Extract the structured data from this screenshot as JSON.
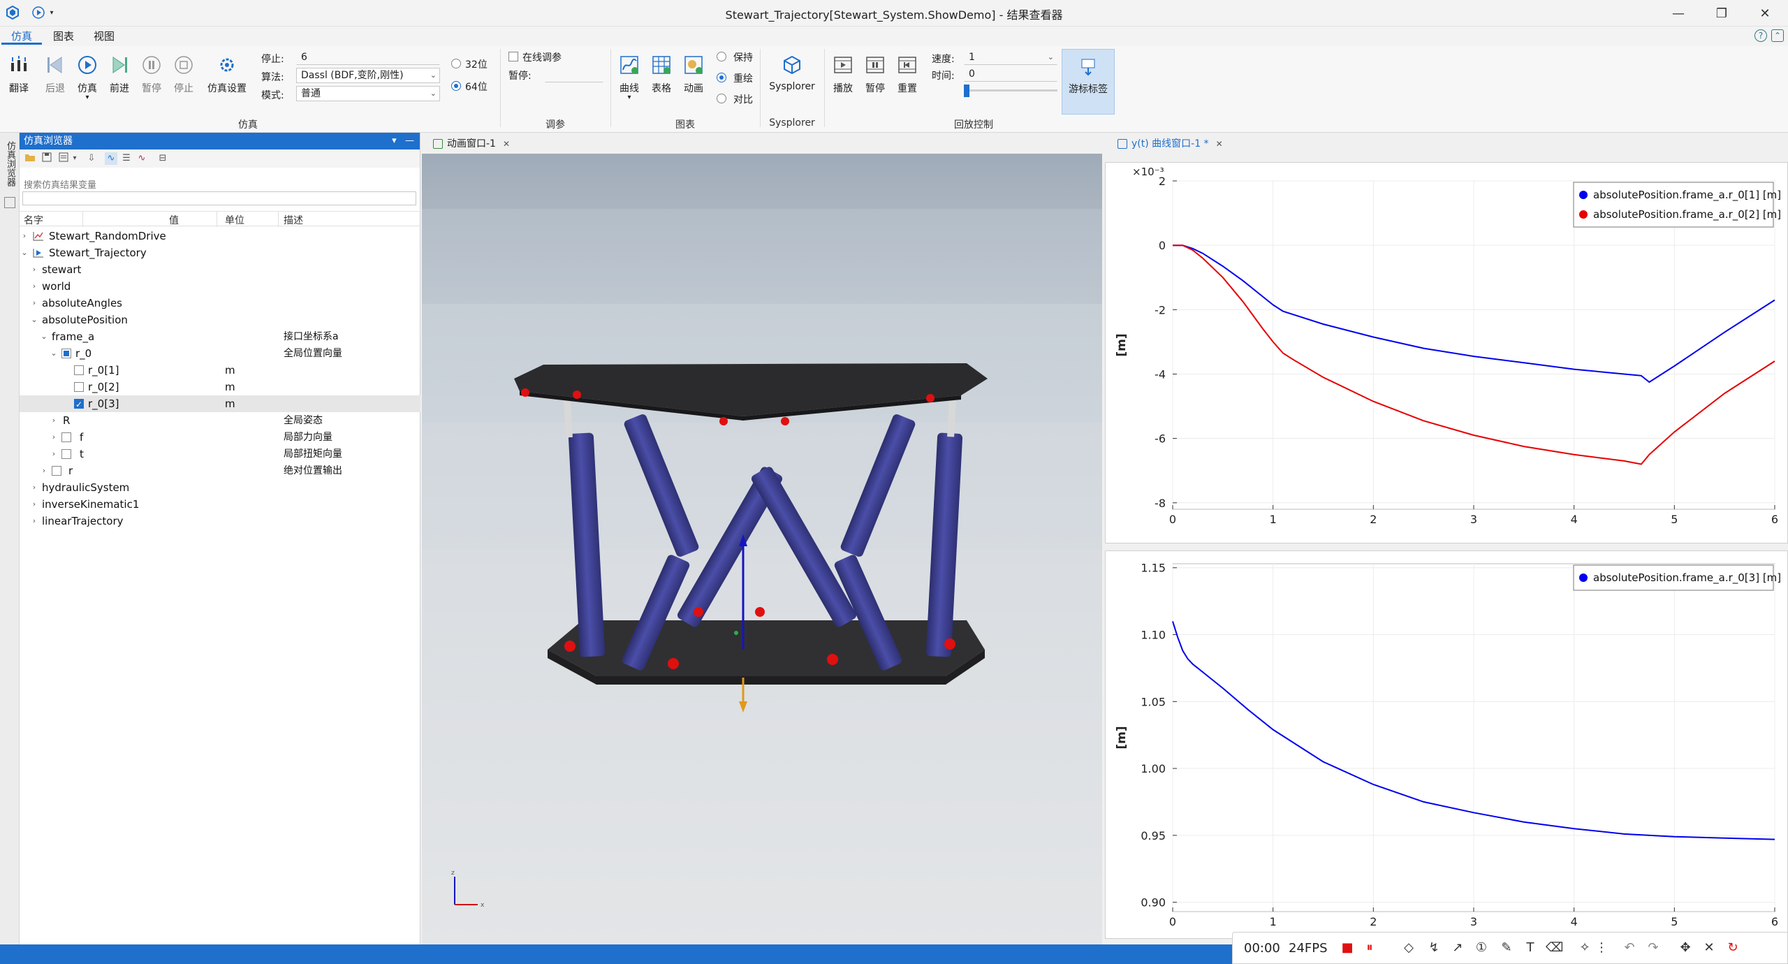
{
  "window": {
    "title": "Stewart_Trajectory[Stewart_System.ShowDemo] - 结果查看器",
    "controls": [
      "—",
      "❐",
      "✕"
    ]
  },
  "menu_tabs": [
    "仿真",
    "图表",
    "视图"
  ],
  "ribbon": {
    "sim_buttons": [
      "翻译",
      "后退",
      "仿真",
      "前进",
      "暂停",
      "停止",
      "仿真设置"
    ],
    "stop_label": "停止:",
    "stop_value": "6",
    "algo_label": "算法:",
    "algo_value": "Dassl (BDF,变阶,刚性)",
    "mode_label": "模式:",
    "mode_value": "普通",
    "bit32": "32位",
    "bit64": "64位",
    "sim_group": "仿真",
    "online_tune": "在线调参",
    "pause_label": "暂停:",
    "tune_group": "调参",
    "chart_buttons": [
      "曲线",
      "表格",
      "动画"
    ],
    "chart_radios": [
      "保持",
      "重绘",
      "对比"
    ],
    "chart_group": "图表",
    "sysplorer_button": "Sysplorer",
    "sysplorer_group": "Sysplorer",
    "playback_buttons": [
      "播放",
      "暂停",
      "重置"
    ],
    "speed_label": "速度:",
    "speed_value": "1",
    "time_label": "时间:",
    "time_value": "0",
    "cursor_tag": "游标标签",
    "playback_group": "回放控制"
  },
  "browser": {
    "vertical_tab": "仿真浏览器",
    "title": "仿真浏览器",
    "search_label": "搜索仿真结果变量",
    "columns": [
      "名字",
      "值",
      "单位",
      "描述"
    ],
    "tree": {
      "r0": "Stewart_RandomDrive",
      "r1": "Stewart_Trajectory",
      "r2": "stewart",
      "r3": "world",
      "r4": "absoluteAngles",
      "r5": "absolutePosition",
      "r6": "frame_a",
      "r6_desc": "接口坐标系a",
      "r7": "r_0",
      "r7_desc": "全局位置向量",
      "r8": "r_0[1]",
      "r8_unit": "m",
      "r9": "r_0[2]",
      "r9_unit": "m",
      "r10": "r_0[3]",
      "r10_unit": "m",
      "r11": "R",
      "r11_desc": "全局姿态",
      "r12": "f",
      "r12_desc": "局部力向量",
      "r13": "t",
      "r13_desc": "局部扭矩向量",
      "r14": "r",
      "r14_desc": "绝对位置输出",
      "r15": "hydraulicSystem",
      "r16": "inverseKinematic1",
      "r17": "linearTrajectory"
    }
  },
  "anim_tab": "动画窗口-1",
  "plot_tab": "y(t) 曲线窗口-1 *",
  "colors": {
    "accent": "#1f6fcc",
    "series_blue": "#0000ee",
    "series_red": "#e60000",
    "actuator": "#3c3e8e",
    "joint": "#e01010"
  },
  "recorder": {
    "time": "00:00",
    "fps": "24FPS"
  },
  "chart_data": [
    {
      "type": "line",
      "exponent_label": "×10⁻³",
      "ylabel": "[m]",
      "xlim": [
        0,
        6
      ],
      "ylim": [
        -8.2,
        2.0
      ],
      "xticks": [
        "0",
        "1",
        "2",
        "3",
        "4",
        "5",
        "6"
      ],
      "yticks": [
        "2",
        "0",
        "-2",
        "-4",
        "-6",
        "-8"
      ],
      "ytick_values": [
        2,
        0,
        -2,
        -4,
        -6,
        -8
      ],
      "legend_position": "top-right",
      "series": [
        {
          "name": "absolutePosition.frame_a.r_0[1] [m]",
          "color": "#0000ee",
          "x": [
            0,
            0.1,
            0.2,
            0.3,
            0.5,
            0.7,
            0.9,
            1.0,
            1.1,
            1.2,
            1.5,
            2.0,
            2.5,
            3.0,
            3.5,
            4.0,
            4.5,
            4.67,
            4.75,
            5.0,
            5.5,
            6.0
          ],
          "y": [
            0,
            0,
            -0.1,
            -0.25,
            -0.65,
            -1.1,
            -1.6,
            -1.85,
            -2.05,
            -2.15,
            -2.45,
            -2.85,
            -3.2,
            -3.45,
            -3.65,
            -3.85,
            -4.0,
            -4.05,
            -4.25,
            -3.75,
            -2.7,
            -1.7
          ]
        },
        {
          "name": "absolutePosition.frame_a.r_0[2] [m]",
          "color": "#e60000",
          "x": [
            0,
            0.1,
            0.2,
            0.3,
            0.5,
            0.7,
            0.9,
            1.0,
            1.1,
            1.2,
            1.5,
            2.0,
            2.5,
            3.0,
            3.5,
            4.0,
            4.5,
            4.67,
            4.75,
            5.0,
            5.5,
            6.0
          ],
          "y": [
            0,
            0,
            -0.15,
            -0.4,
            -1.0,
            -1.75,
            -2.6,
            -3.0,
            -3.35,
            -3.55,
            -4.1,
            -4.85,
            -5.45,
            -5.9,
            -6.25,
            -6.5,
            -6.7,
            -6.8,
            -6.5,
            -5.8,
            -4.6,
            -3.6
          ]
        }
      ]
    },
    {
      "type": "line",
      "ylabel": "[m]",
      "xlim": [
        0,
        6
      ],
      "ylim": [
        0.893,
        1.153
      ],
      "xticks": [
        "0",
        "1",
        "2",
        "3",
        "4",
        "5",
        "6"
      ],
      "yticks": [
        "1.15",
        "1.10",
        "1.05",
        "1.00",
        "0.95",
        "0.90"
      ],
      "ytick_values": [
        1.15,
        1.1,
        1.05,
        1.0,
        0.95,
        0.9
      ],
      "legend_position": "top-right",
      "series": [
        {
          "name": "absolutePosition.frame_a.r_0[3] [m]",
          "color": "#0000ee",
          "x": [
            0,
            0.05,
            0.1,
            0.15,
            0.2,
            0.3,
            0.5,
            0.75,
            1.0,
            1.5,
            2.0,
            2.5,
            3.0,
            3.5,
            4.0,
            4.5,
            5.0,
            5.5,
            6.0
          ],
          "y": [
            1.11,
            1.098,
            1.088,
            1.082,
            1.078,
            1.072,
            1.06,
            1.044,
            1.029,
            1.005,
            0.988,
            0.975,
            0.967,
            0.96,
            0.955,
            0.951,
            0.949,
            0.948,
            0.947
          ]
        }
      ]
    }
  ]
}
